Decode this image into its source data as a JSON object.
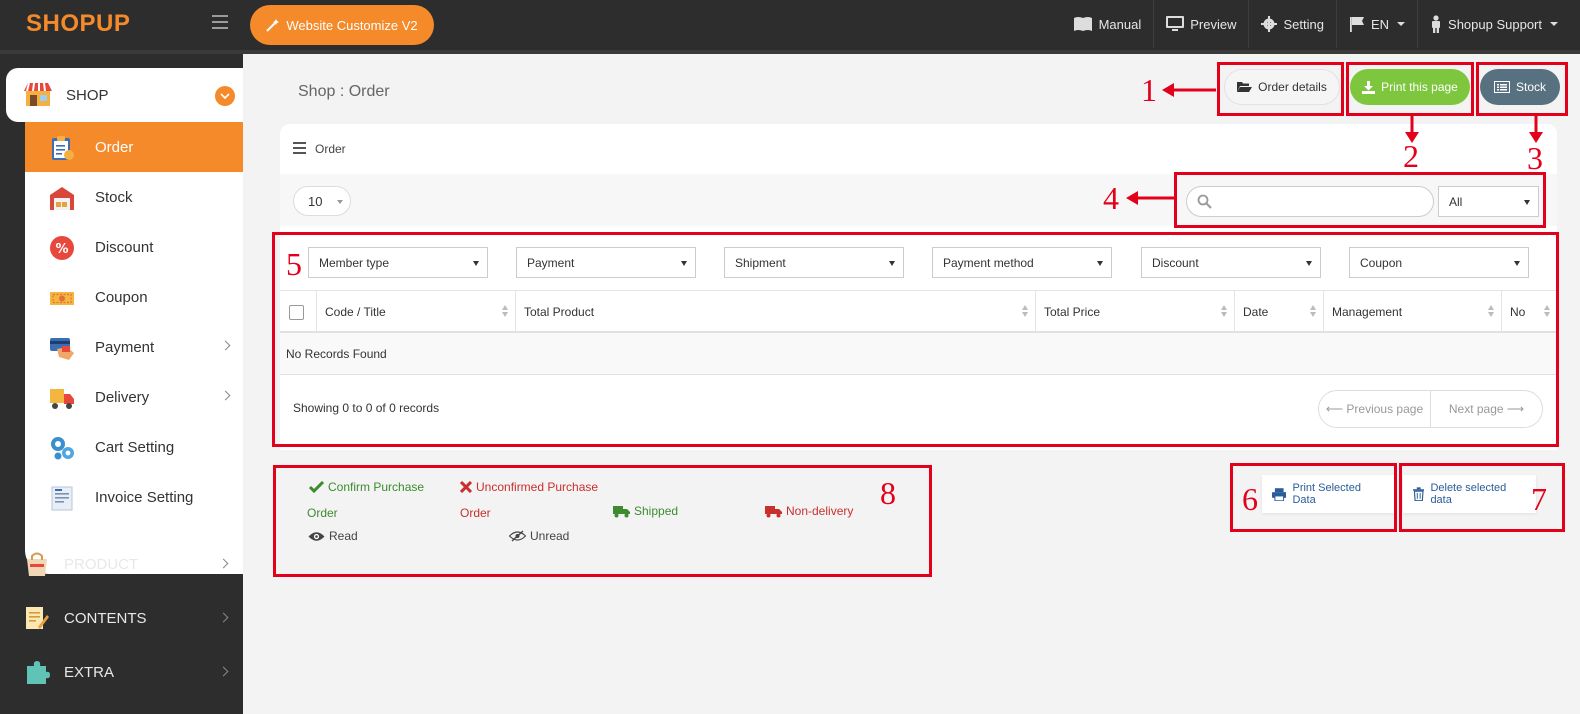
{
  "app": {
    "logo": "SHOPUP",
    "customize_label": "Website Customize V2"
  },
  "topnav": {
    "manual": "Manual",
    "preview": "Preview",
    "setting": "Setting",
    "language": "EN",
    "user": "Shopup Support"
  },
  "sidebar": {
    "shop_label": "SHOP",
    "sub_items": [
      {
        "label": "Order",
        "icon": "order-clipboard-icon",
        "active": true
      },
      {
        "label": "Stock",
        "icon": "warehouse-icon"
      },
      {
        "label": "Discount",
        "icon": "percent-badge-icon"
      },
      {
        "label": "Coupon",
        "icon": "coupon-ticket-icon"
      },
      {
        "label": "Payment",
        "icon": "credit-card-hand-icon",
        "submenu": true
      },
      {
        "label": "Delivery",
        "icon": "delivery-truck-icon",
        "submenu": true
      },
      {
        "label": "Cart Setting",
        "icon": "gears-icon"
      },
      {
        "label": "Invoice Setting",
        "icon": "invoice-icon"
      }
    ],
    "main_items": [
      {
        "label": "PRODUCT",
        "icon": "shopping-bag-icon"
      },
      {
        "label": "CONTENTS",
        "icon": "document-pencil-icon"
      },
      {
        "label": "EXTRA",
        "icon": "puzzle-icon"
      }
    ]
  },
  "page": {
    "title": "Shop : Order",
    "buttons": {
      "order_details": "Order details",
      "print_page": "Print this page",
      "stock": "Stock"
    }
  },
  "panel": {
    "header": "Order",
    "page_length": "10",
    "search_placeholder": "",
    "status_filter": "All",
    "filters": [
      "Member type",
      "Payment",
      "Shipment",
      "Payment method",
      "Discount",
      "Coupon"
    ],
    "columns": [
      "Code / Title",
      "Total Product",
      "Total Price",
      "Date",
      "Management",
      "No"
    ],
    "empty_text": "No Records Found",
    "showing": "Showing 0 to 0 of 0 records",
    "prev": "⟵ Previous page",
    "next": "Next page ⟶"
  },
  "legend": {
    "confirm": "Confirm Purchase",
    "confirm_order": "Order",
    "unconfirmed": "Unconfirmed Purchase",
    "unconfirmed_order": "Order",
    "shipped": "Shipped",
    "non_delivery": "Non-delivery",
    "read": "Read",
    "unread": "Unread"
  },
  "actions": {
    "print_selected": "Print Selected Data",
    "delete_selected": "Delete selected data"
  },
  "annotations": [
    "1",
    "2",
    "3",
    "4",
    "5",
    "6",
    "7",
    "8"
  ],
  "colors": {
    "brand": "#f58a2a",
    "print": "#7dc63e",
    "stock": "#587181",
    "annotation": "#e3001b",
    "topbar": "#2d2d2d"
  }
}
